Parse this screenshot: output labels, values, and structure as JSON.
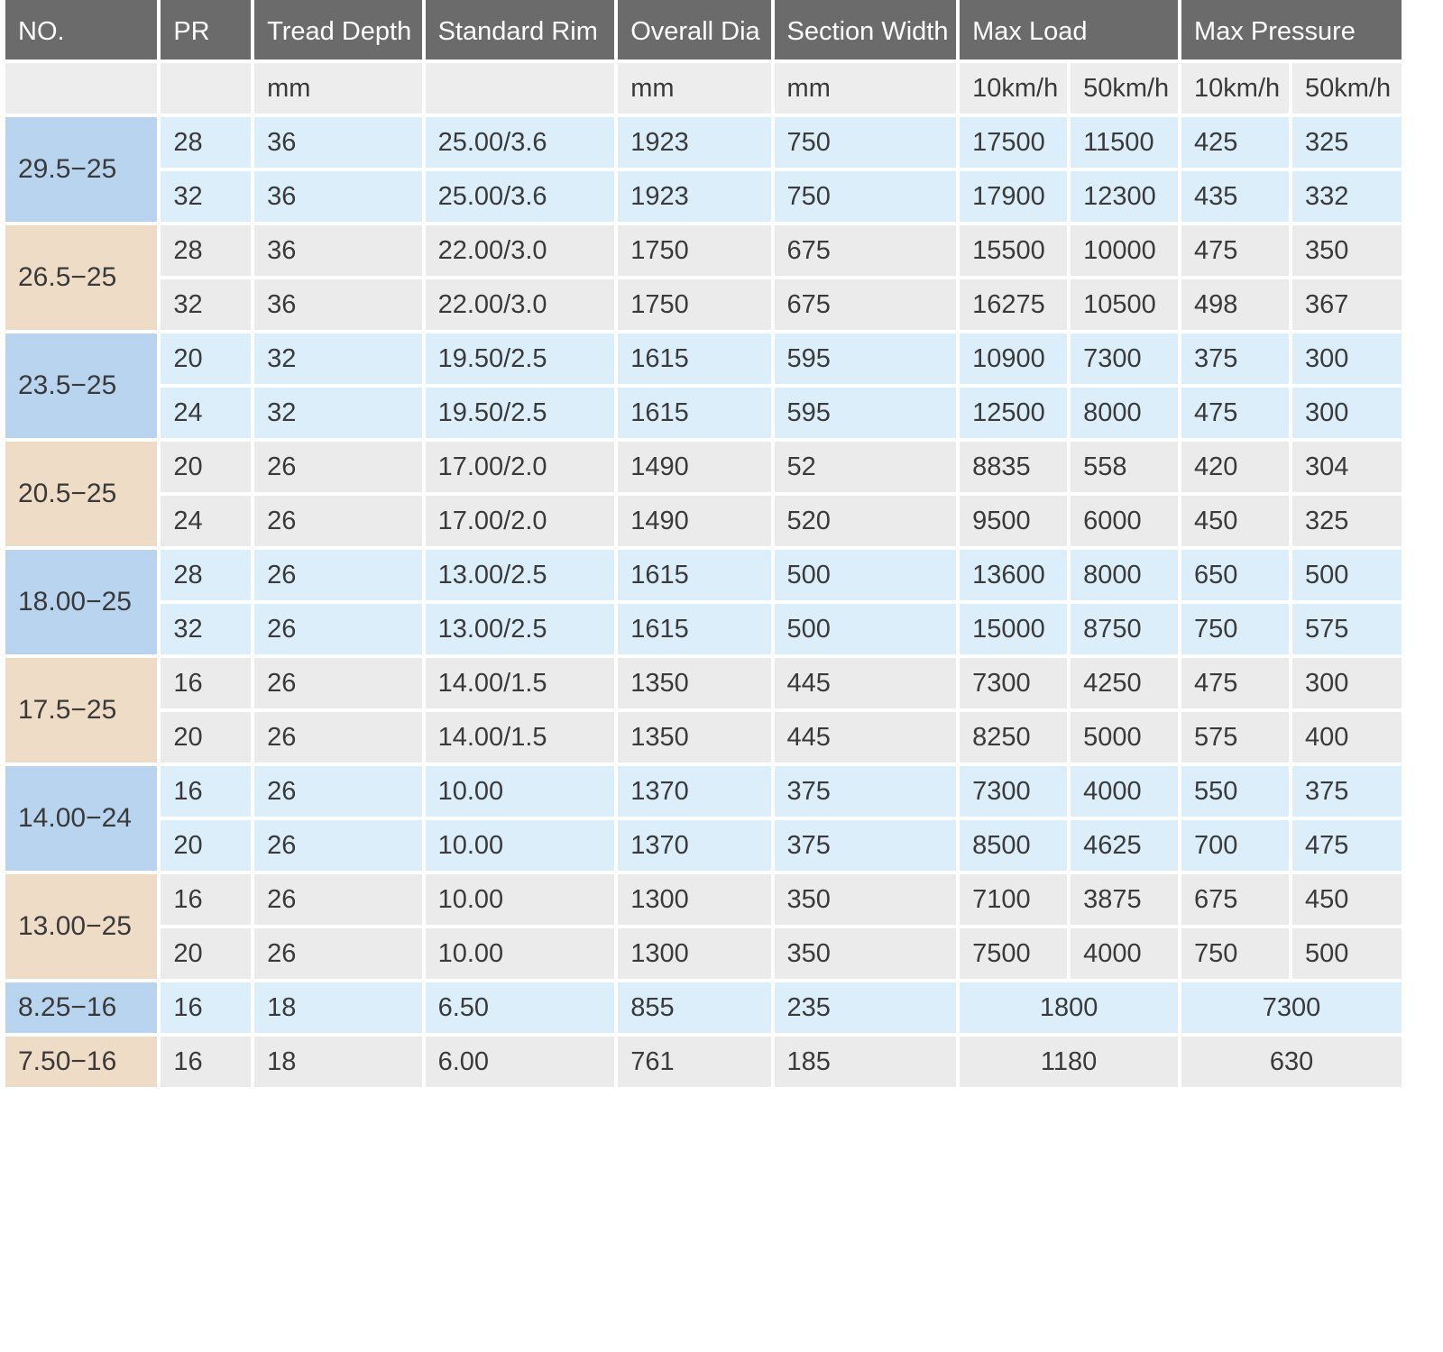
{
  "headers": {
    "no": "NO.",
    "pr": "PR",
    "tread_depth": "Tread Depth",
    "standard_rim": "Standard Rim",
    "overall_dia": "Overall Dia",
    "section_width": "Section Width",
    "max_load": "Max Load",
    "max_pressure": "Max Pressure"
  },
  "units": {
    "no": "",
    "pr": "",
    "tread_depth": "mm",
    "standard_rim": "",
    "overall_dia": "mm",
    "section_width": "mm",
    "load_10": "10km/h",
    "load_50": "50km/h",
    "pressure_10": "10km/h",
    "pressure_50": "50km/h"
  },
  "groups": [
    {
      "size": "29.5−25",
      "tone": "blue",
      "rows": [
        {
          "pr": "28",
          "tread": "36",
          "rim": "25.00/3.6",
          "dia": "1923",
          "width": "750",
          "load10": "17500",
          "load50": "11500",
          "p10": "425",
          "p50": "325"
        },
        {
          "pr": "32",
          "tread": "36",
          "rim": "25.00/3.6",
          "dia": "1923",
          "width": "750",
          "load10": "17900",
          "load50": "12300",
          "p10": "435",
          "p50": "332"
        }
      ]
    },
    {
      "size": "26.5−25",
      "tone": "gray",
      "rows": [
        {
          "pr": "28",
          "tread": "36",
          "rim": "22.00/3.0",
          "dia": "1750",
          "width": "675",
          "load10": "15500",
          "load50": "10000",
          "p10": "475",
          "p50": "350"
        },
        {
          "pr": "32",
          "tread": "36",
          "rim": "22.00/3.0",
          "dia": "1750",
          "width": "675",
          "load10": "16275",
          "load50": "10500",
          "p10": "498",
          "p50": "367"
        }
      ]
    },
    {
      "size": "23.5−25",
      "tone": "blue",
      "rows": [
        {
          "pr": "20",
          "tread": "32",
          "rim": "19.50/2.5",
          "dia": "1615",
          "width": "595",
          "load10": "10900",
          "load50": "7300",
          "p10": "375",
          "p50": "300"
        },
        {
          "pr": "24",
          "tread": "32",
          "rim": "19.50/2.5",
          "dia": "1615",
          "width": "595",
          "load10": "12500",
          "load50": "8000",
          "p10": "475",
          "p50": "300"
        }
      ]
    },
    {
      "size": "20.5−25",
      "tone": "gray",
      "rows": [
        {
          "pr": "20",
          "tread": "26",
          "rim": "17.00/2.0",
          "dia": "1490",
          "width": "52",
          "load10": "8835",
          "load50": "558",
          "p10": "420",
          "p50": "304"
        },
        {
          "pr": "24",
          "tread": "26",
          "rim": "17.00/2.0",
          "dia": "1490",
          "width": "520",
          "load10": "9500",
          "load50": "6000",
          "p10": "450",
          "p50": "325"
        }
      ]
    },
    {
      "size": "18.00−25",
      "tone": "blue",
      "rows": [
        {
          "pr": "28",
          "tread": "26",
          "rim": "13.00/2.5",
          "dia": "1615",
          "width": "500",
          "load10": "13600",
          "load50": "8000",
          "p10": "650",
          "p50": "500"
        },
        {
          "pr": "32",
          "tread": "26",
          "rim": "13.00/2.5",
          "dia": "1615",
          "width": "500",
          "load10": "15000",
          "load50": "8750",
          "p10": "750",
          "p50": "575"
        }
      ]
    },
    {
      "size": "17.5−25",
      "tone": "gray",
      "rows": [
        {
          "pr": "16",
          "tread": "26",
          "rim": "14.00/1.5",
          "dia": "1350",
          "width": "445",
          "load10": "7300",
          "load50": "4250",
          "p10": "475",
          "p50": "300"
        },
        {
          "pr": "20",
          "tread": "26",
          "rim": "14.00/1.5",
          "dia": "1350",
          "width": "445",
          "load10": "8250",
          "load50": "5000",
          "p10": "575",
          "p50": "400"
        }
      ]
    },
    {
      "size": "14.00−24",
      "tone": "blue",
      "rows": [
        {
          "pr": "16",
          "tread": "26",
          "rim": "10.00",
          "dia": "1370",
          "width": "375",
          "load10": "7300",
          "load50": "4000",
          "p10": "550",
          "p50": "375"
        },
        {
          "pr": "20",
          "tread": "26",
          "rim": "10.00",
          "dia": "1370",
          "width": "375",
          "load10": "8500",
          "load50": "4625",
          "p10": "700",
          "p50": "475"
        }
      ]
    },
    {
      "size": "13.00−25",
      "tone": "gray",
      "rows": [
        {
          "pr": "16",
          "tread": "26",
          "rim": "10.00",
          "dia": "1300",
          "width": "350",
          "load10": "7100",
          "load50": "3875",
          "p10": "675",
          "p50": "450"
        },
        {
          "pr": "20",
          "tread": "26",
          "rim": "10.00",
          "dia": "1300",
          "width": "350",
          "load10": "7500",
          "load50": "4000",
          "p10": "750",
          "p50": "500"
        }
      ]
    }
  ],
  "singles": [
    {
      "size": "8.25−16",
      "tone": "blue",
      "pr": "16",
      "tread": "18",
      "rim": "6.50",
      "dia": "855",
      "width": "235",
      "load": "1800",
      "pressure": "7300"
    },
    {
      "size": "7.50−16",
      "tone": "gray",
      "pr": "16",
      "tread": "18",
      "rim": "6.00",
      "dia": "761",
      "width": "185",
      "load": "1180",
      "pressure": "630"
    }
  ],
  "colors": {
    "header_bg": "#6b6b6b",
    "size_blue": "#b9d4ef",
    "size_tan": "#efdcc6",
    "row_blue": "#dceefa",
    "row_gray": "#ebebeb"
  }
}
